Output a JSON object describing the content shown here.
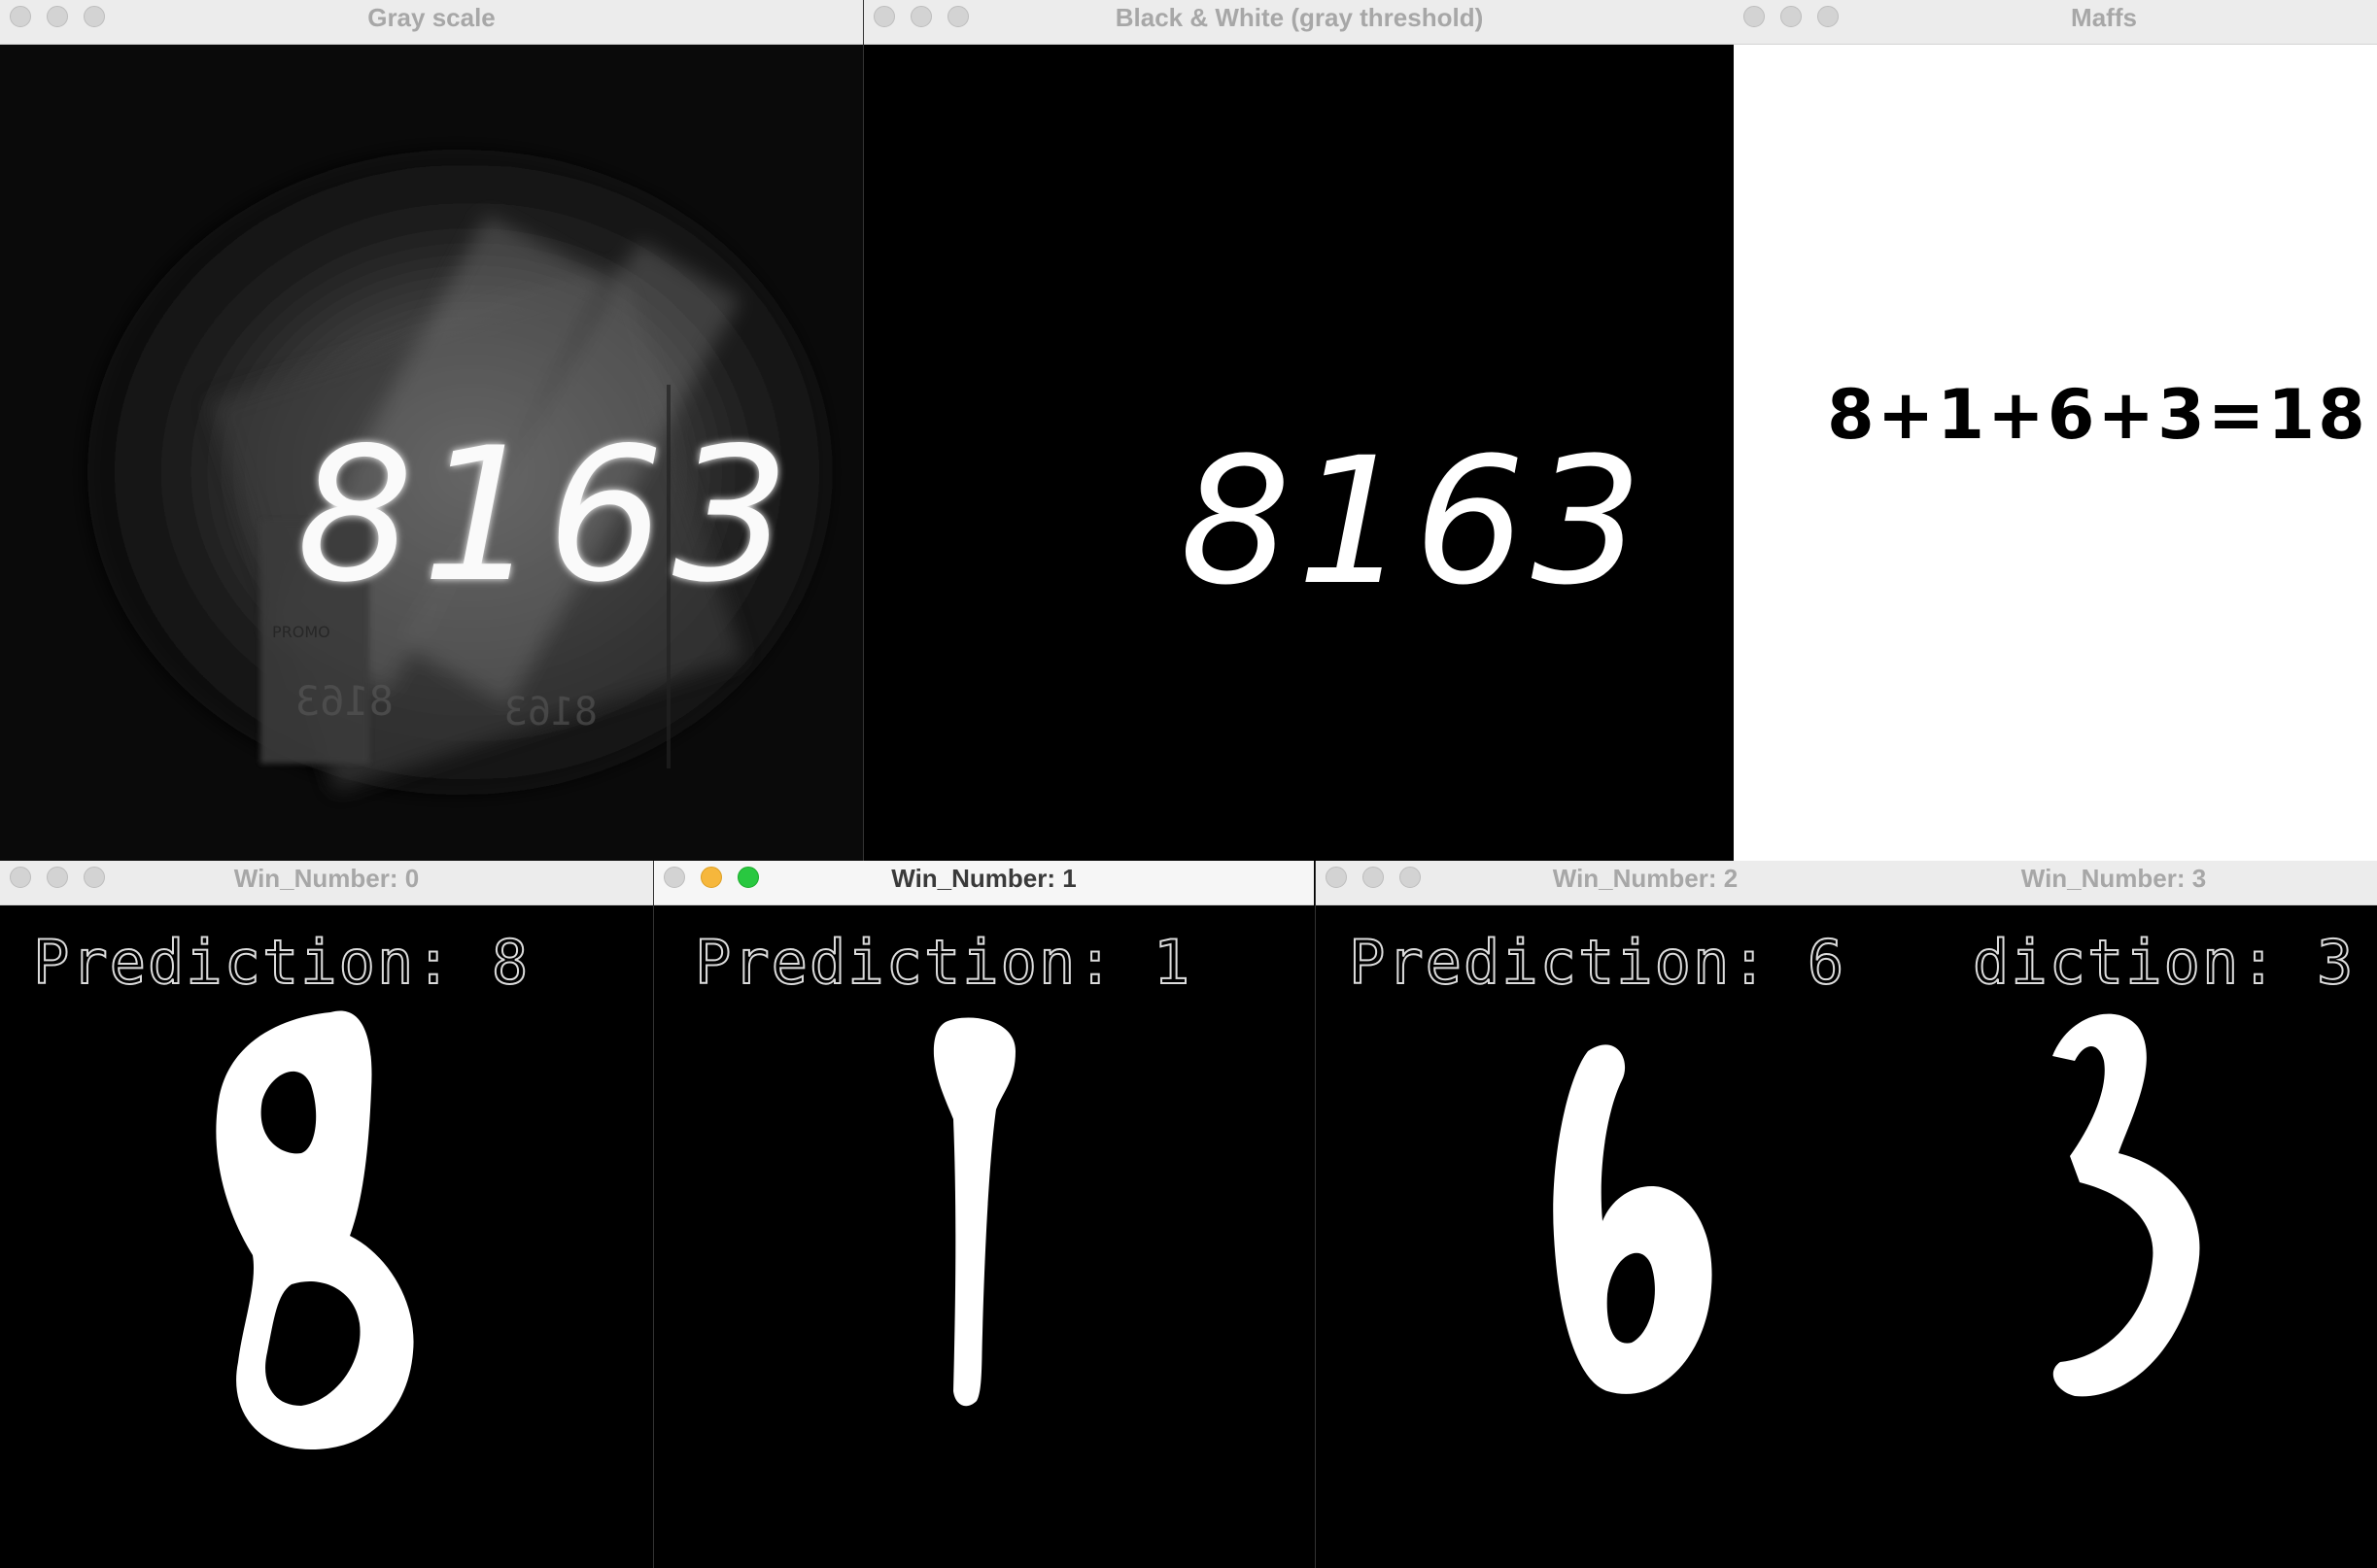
{
  "windows": {
    "gray_scale": {
      "title": "Gray scale",
      "number_text": "8163",
      "reflection_text_1": "8163",
      "reflection_text_2": "8163",
      "label_text": "PROMO"
    },
    "bw_threshold": {
      "title": "Black & White (gray threshold)",
      "number_text": "8163"
    },
    "maffs": {
      "title": "Maffs",
      "equation": "8+1+6+3=18"
    },
    "win0": {
      "title": "Win_Number: 0",
      "prediction": "Prediction: 8",
      "digit": "8"
    },
    "win1": {
      "title": "Win_Number: 1",
      "prediction": "Prediction: 1",
      "digit": "1"
    },
    "win2": {
      "title": "Win_Number: 2",
      "prediction": "Prediction: 6",
      "digit": "6"
    },
    "win3": {
      "title": "Win_Number: 3",
      "prediction": "diction: 3",
      "digit": "3"
    }
  },
  "colors": {
    "traffic_close": "#ff5f57",
    "traffic_min": "#f6b73c",
    "traffic_max": "#29c840",
    "inactive_light": "#d3d3d3"
  },
  "icons": [
    "close-icon",
    "minimize-icon",
    "zoom-icon"
  ]
}
